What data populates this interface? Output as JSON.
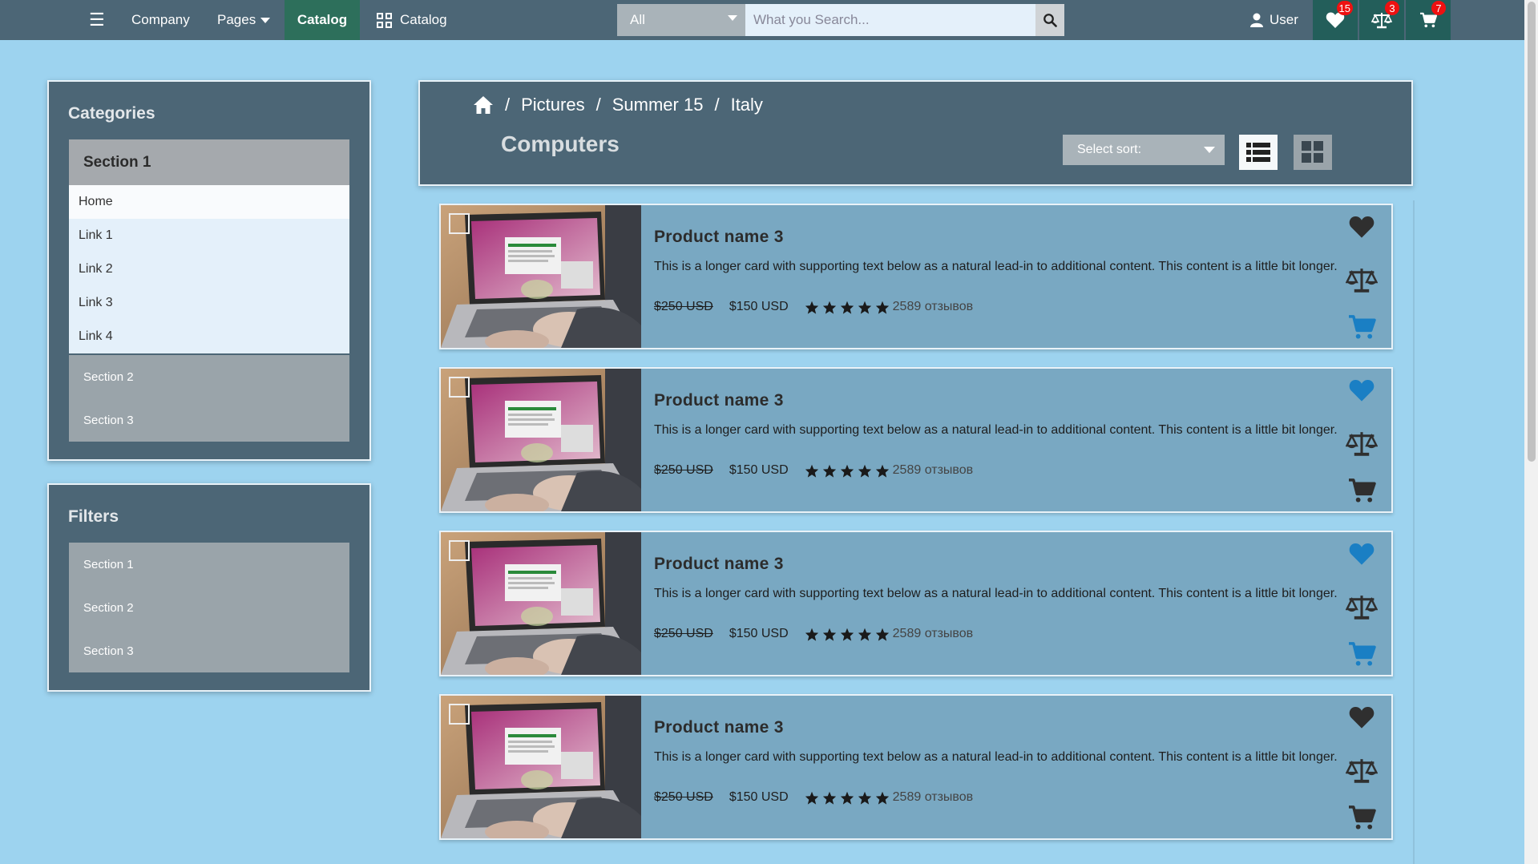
{
  "nav": {
    "company": "Company",
    "pages": "Pages",
    "catalog_active": "Catalog",
    "catalog": "Catalog",
    "search_category": "All",
    "search_placeholder": "What you Search...",
    "user": "User",
    "wishlist_count": "15",
    "compare_count": "3",
    "cart_count": "7"
  },
  "sidebar": {
    "categories_title": "Categories",
    "open_section": "Section 1",
    "links": [
      "Home",
      "Link 1",
      "Link 2",
      "Link 3",
      "Link 4"
    ],
    "closed_sections": [
      "Section 2",
      "Section 3"
    ],
    "filters_title": "Filters",
    "filter_sections": [
      "Section 1",
      "Section 2",
      "Section 3"
    ]
  },
  "header": {
    "breadcrumb": [
      "Pictures",
      "Summer 15",
      "Italy"
    ],
    "title": "Computers",
    "sort_placeholder": "Select sort:"
  },
  "products": [
    {
      "name": "Product name 3",
      "description": "This is a longer card with supporting text below as a natural lead-in to additional content. This content is a little bit longer.",
      "old_price": "$250 USD",
      "price": "$150 USD",
      "reviews": "2589 отзывов",
      "rating": 5,
      "favorited": false,
      "in_cart": true
    },
    {
      "name": "Product name 3",
      "description": "This is a longer card with supporting text below as a natural lead-in to additional content. This content is a little bit longer.",
      "old_price": "$250 USD",
      "price": "$150 USD",
      "reviews": "2589 отзывов",
      "rating": 5,
      "favorited": true,
      "in_cart": false
    },
    {
      "name": "Product name 3",
      "description": "This is a longer card with supporting text below as a natural lead-in to additional content. This content is a little bit longer.",
      "old_price": "$250 USD",
      "price": "$150 USD",
      "reviews": "2589 отзывов",
      "rating": 5,
      "favorited": true,
      "in_cart": true
    },
    {
      "name": "Product name 3",
      "description": "This is a longer card with supporting text below as a natural lead-in to additional content. This content is a little bit longer.",
      "old_price": "$250 USD",
      "price": "$150 USD",
      "reviews": "2589 отзывов",
      "rating": 5,
      "favorited": false,
      "in_cart": false
    }
  ],
  "colors": {
    "navbar": "#4c6676",
    "background": "#9dd3ef",
    "active_blue": "#1a7fc4",
    "inactive_dark": "#2f2f2f"
  }
}
